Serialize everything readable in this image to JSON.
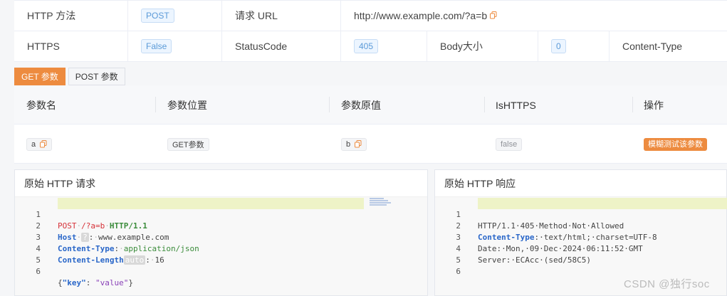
{
  "info": {
    "method_label": "HTTP 方法",
    "method_value": "POST",
    "url_label": "请求 URL",
    "url_value": "http://www.example.com/?a=b",
    "https_label": "HTTPS",
    "https_value": "False",
    "status_label": "StatusCode",
    "status_value": "405",
    "body_label": "Body大小",
    "body_value": "0",
    "content_type_label": "Content-Type"
  },
  "tabs": [
    {
      "label": "GET 参数",
      "active": true
    },
    {
      "label": "POST 参数",
      "active": false
    }
  ],
  "params": {
    "headers": [
      "参数名",
      "参数位置",
      "参数原值",
      "IsHTTPS",
      "操作"
    ],
    "rows": [
      {
        "name": "a",
        "position": "GET参数",
        "value": "b",
        "is_https": "false",
        "action": "模糊测试该参数"
      }
    ]
  },
  "request_panel": {
    "title": "原始 HTTP 请求",
    "line_numbers": [
      "1",
      "2",
      "3",
      "4",
      "5",
      "6"
    ],
    "lines": {
      "l1_method": "POST",
      "l1_path": "/?a=b",
      "l1_version": "HTTP/1.1",
      "l2_key": "Host",
      "l2_inlay": "?",
      "l2_value": "www.example.com",
      "l3_key": "Content-Type",
      "l3_value": "application/json",
      "l4_key": "Content-Length",
      "l4_inlay": "auto",
      "l4_value": "16",
      "l6_open": "{",
      "l6_key": "\"key\"",
      "l6_colon": ": ",
      "l6_value": "\"value\"",
      "l6_close": "}"
    }
  },
  "response_panel": {
    "title": "原始 HTTP 响应",
    "line_numbers": [
      "1",
      "2",
      "3",
      "4",
      "5",
      "6"
    ],
    "lines": {
      "l1": "HTTP/1.1·405·Method·Not·Allowed",
      "l2_key": "Content-Type",
      "l2_value": "·text/html;·charset=UTF-8",
      "l3": "Date:·Mon,·09·Dec·2024·06:11:52·GMT",
      "l4": "Server:·ECAcc·(sed/58C5)"
    }
  },
  "watermark": "CSDN @独行soc",
  "colors": {
    "accent": "#ed8b3f",
    "tag_blue": "#5b9ad8",
    "highlight": "#eef3c7"
  }
}
